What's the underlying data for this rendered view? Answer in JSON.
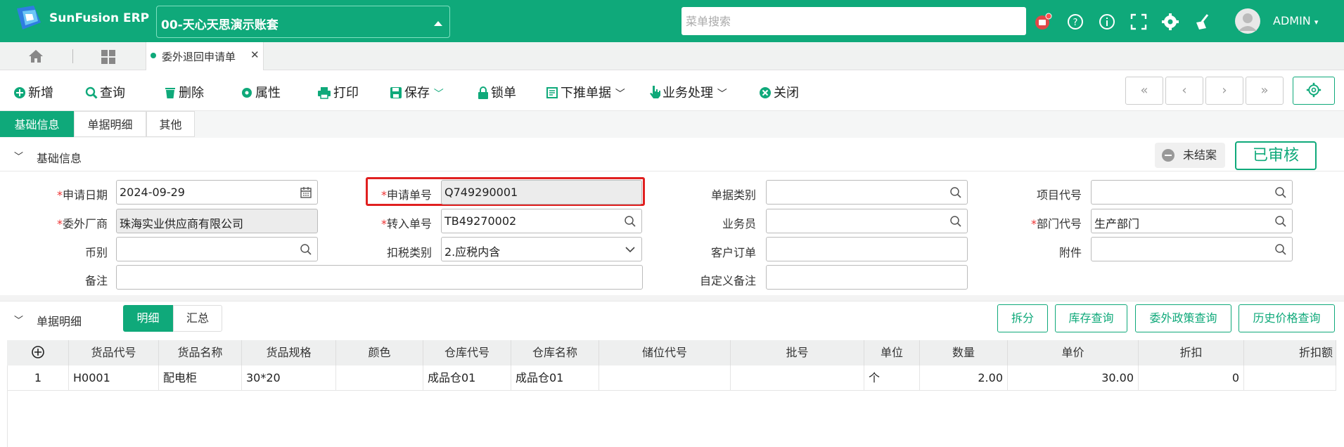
{
  "app": {
    "name": "SunFusion ERP",
    "account": "00-天心天思演示账套",
    "user": "ADMIN"
  },
  "search": {
    "placeholder": "菜单搜索"
  },
  "tabs": {
    "open_tab": "委外退回申请单"
  },
  "toolbar": {
    "new": "新增",
    "query": "查询",
    "delete": "删除",
    "properties": "属性",
    "print": "打印",
    "save": "保存",
    "lock": "锁单",
    "push_down": "下推单据",
    "business": "业务处理",
    "close": "关闭"
  },
  "nav": {
    "first": "«",
    "prev": "‹",
    "next": "›",
    "last": "»"
  },
  "subtabs": [
    "基础信息",
    "单据明细",
    "其他"
  ],
  "basic": {
    "section_title": "基础信息",
    "unsettled": "未结案",
    "approved": "已审核",
    "fields": {
      "apply_date": {
        "label": "申请日期",
        "value": "2024-09-29"
      },
      "apply_no": {
        "label": "申请单号",
        "value": "Q749290001"
      },
      "doc_type": {
        "label": "单据类别",
        "value": ""
      },
      "project_code": {
        "label": "项目代号",
        "value": ""
      },
      "vendor": {
        "label": "委外厂商",
        "value": "珠海实业供应商有限公司"
      },
      "transfer_no": {
        "label": "转入单号",
        "value": "TB49270002"
      },
      "salesman": {
        "label": "业务员",
        "value": ""
      },
      "dept_code": {
        "label": "部门代号",
        "value": "生产部门"
      },
      "currency": {
        "label": "币别",
        "value": ""
      },
      "tax_type": {
        "label": "扣税类别",
        "value": "2.应税内含"
      },
      "customer_order": {
        "label": "客户订单",
        "value": ""
      },
      "attachment": {
        "label": "附件",
        "value": ""
      },
      "remark": {
        "label": "备注",
        "value": ""
      },
      "custom_remark": {
        "label": "自定义备注",
        "value": ""
      }
    }
  },
  "detail": {
    "section_title": "单据明细",
    "view_detail": "明细",
    "view_summary": "汇总",
    "actions": {
      "split": "拆分",
      "stock_query": "库存查询",
      "policy_query": "委外政策查询",
      "price_history": "历史价格查询"
    },
    "columns": [
      "货品代号",
      "货品名称",
      "货品规格",
      "颜色",
      "仓库代号",
      "仓库名称",
      "储位代号",
      "批号",
      "单位",
      "数量",
      "单价",
      "折扣",
      "折扣额"
    ],
    "rows": [
      {
        "no": "1",
        "code": "H0001",
        "name": "配电柜",
        "spec": "30*20",
        "color": "",
        "wh_code": "成品仓01",
        "wh_name": "成品仓01",
        "loc": "",
        "batch": "",
        "unit": "个",
        "qty": "2.00",
        "price": "30.00",
        "discount": "0",
        "discount_amt": ""
      }
    ]
  },
  "colors": {
    "primary": "#0fa97a",
    "highlight": "#e02020"
  }
}
